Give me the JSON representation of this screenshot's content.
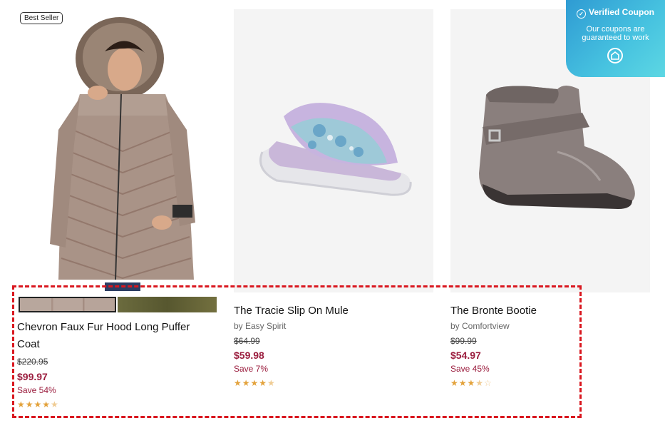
{
  "coupon": {
    "title": "Verified Coupon",
    "subtitle": "Our coupons are guaranteed to work",
    "icons": [
      "check-circle-icon",
      "home-icon"
    ]
  },
  "products": [
    {
      "badge": "Best Seller",
      "name": "Chevron Faux Fur Hood Long Puffer Coat",
      "brand": "",
      "original_price": "$220.95",
      "sale_price": "$99.97",
      "save": "Save 54%",
      "rating": 4.5,
      "swatches": [
        "taupe",
        "olive"
      ]
    },
    {
      "name": "The Tracie Slip On Mule",
      "brand": "by Easy Spirit",
      "original_price": "$64.99",
      "sale_price": "$59.98",
      "save": "Save 7%",
      "rating": 4.5
    },
    {
      "name": "The Bronte Bootie",
      "brand": "by Comfortview",
      "original_price": "$99.99",
      "sale_price": "$54.97",
      "save": "Save 45%",
      "rating": 3.5
    }
  ],
  "colors": {
    "sale_price": "#9b1d3e",
    "star": "#e3a23b",
    "highlight_border": "#d9171f",
    "coupon_gradient_start": "#2f9bd3",
    "coupon_gradient_end": "#5dd7e3"
  }
}
